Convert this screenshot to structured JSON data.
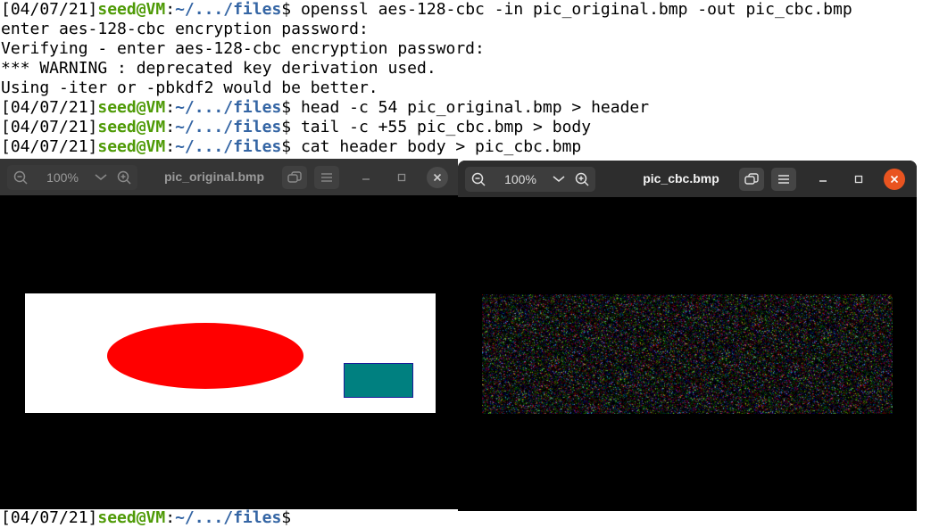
{
  "terminal": {
    "lines": [
      {
        "ts": "[04/07/21]",
        "user": "seed@VM",
        "path": "~/.../files",
        "cmd": "$ openssl aes-128-cbc -in pic_original.bmp -out pic_cbc.bmp"
      },
      {
        "text": "enter aes-128-cbc encryption password:"
      },
      {
        "text": "Verifying - enter aes-128-cbc encryption password:"
      },
      {
        "text": "*** WARNING : deprecated key derivation used."
      },
      {
        "text": "Using -iter or -pbkdf2 would be better."
      },
      {
        "ts": "[04/07/21]",
        "user": "seed@VM",
        "path": "~/.../files",
        "cmd": "$ head -c 54 pic_original.bmp > header"
      },
      {
        "ts": "[04/07/21]",
        "user": "seed@VM",
        "path": "~/.../files",
        "cmd": "$ tail -c +55 pic_cbc.bmp > body"
      },
      {
        "ts": "[04/07/21]",
        "user": "seed@VM",
        "path": "~/.../files",
        "cmd": "$ cat header body > pic_cbc.bmp"
      },
      {
        "ts": "[04/07/21]",
        "user": "seed@VM",
        "path": "~/.../files",
        "cmd": "$"
      }
    ],
    "sep": ":"
  },
  "viewer_original": {
    "zoom": "100%",
    "title": "pic_original.bmp",
    "active": false
  },
  "viewer_cbc": {
    "zoom": "100%",
    "title": "pic_cbc.bmp",
    "active": true
  },
  "colors": {
    "prompt_user": "#4e9a06",
    "prompt_path": "#3465a4",
    "close_active": "#e95420",
    "ellipse": "#ff0000",
    "rectangle": "#008080"
  }
}
